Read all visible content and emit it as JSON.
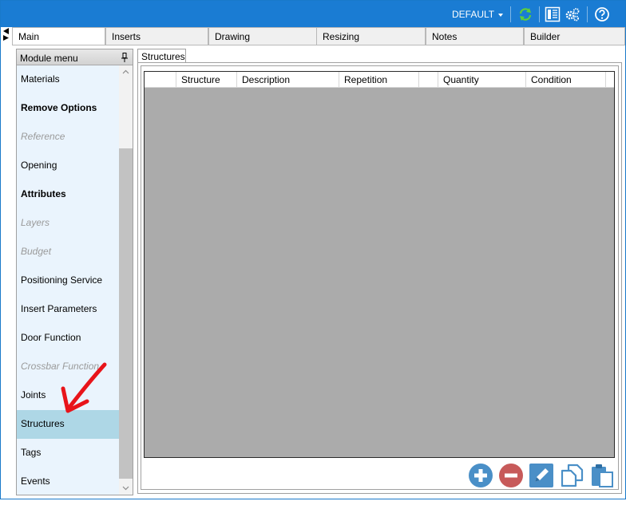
{
  "toolbar": {
    "profile_label": "DEFAULT",
    "icons": [
      "refresh-icon",
      "layout-panel-icon",
      "settings-gears-icon",
      "help-icon"
    ]
  },
  "tabs": [
    {
      "label": "Main",
      "active": true
    },
    {
      "label": "Inserts",
      "active": false
    },
    {
      "label": "Drawing",
      "active": false
    },
    {
      "label": "Resizing",
      "active": false
    },
    {
      "label": "Notes",
      "active": false
    },
    {
      "label": "Builder",
      "active": false
    }
  ],
  "sidebar": {
    "title": "Module menu",
    "items": [
      {
        "label": "Materials",
        "style": "normal"
      },
      {
        "label": "Remove Options",
        "style": "bold"
      },
      {
        "label": "Reference",
        "style": "disabled"
      },
      {
        "label": "Opening",
        "style": "normal"
      },
      {
        "label": "Attributes",
        "style": "bold"
      },
      {
        "label": "Layers",
        "style": "disabled"
      },
      {
        "label": "Budget",
        "style": "disabled"
      },
      {
        "label": "Positioning Service",
        "style": "normal"
      },
      {
        "label": "Insert Parameters",
        "style": "normal"
      },
      {
        "label": "Door Function",
        "style": "normal"
      },
      {
        "label": "Crossbar Function",
        "style": "disabled"
      },
      {
        "label": "Joints",
        "style": "normal"
      },
      {
        "label": "Structures",
        "style": "selected"
      },
      {
        "label": "Tags",
        "style": "normal"
      },
      {
        "label": "Events",
        "style": "normal"
      }
    ]
  },
  "content": {
    "subtab_label": "Structures",
    "columns": [
      "",
      "Structure",
      "Description",
      "Repetition",
      "",
      "Quantity",
      "Condition"
    ]
  },
  "actions": {
    "icons": [
      "add-icon",
      "remove-icon",
      "edit-icon",
      "copy-icon",
      "paste-icon"
    ]
  },
  "colors": {
    "titlebar": "#1a7cd3",
    "selected_item": "#aed7e6",
    "grid_background": "#ababab",
    "add_button": "#4a8fc7",
    "remove_button": "#c75a5a",
    "annotation_arrow": "#e8141a"
  }
}
